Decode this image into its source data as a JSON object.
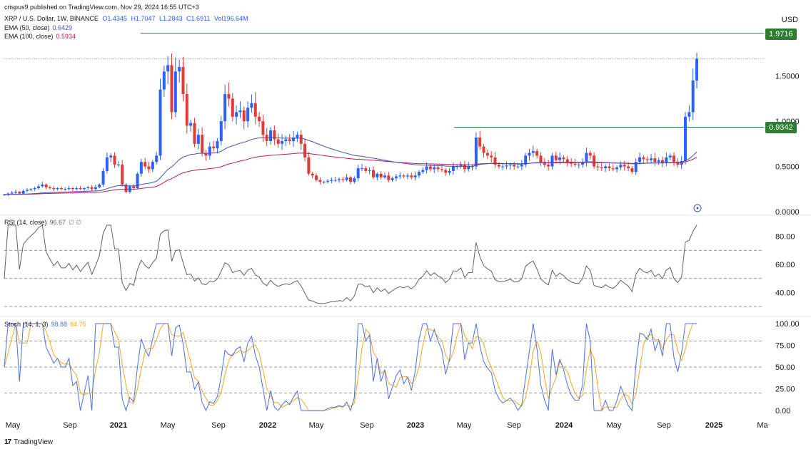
{
  "header": {
    "publisher_line": "crispus9 published on TradingView.com, Nov 29, 2024 16:55 UTC+3",
    "symbol": "XRP / U.S. Dollar, 1W, BINANCE",
    "open": "O1.4345",
    "high": "H1.7047",
    "low": "L1.2843",
    "close": "C1.6911",
    "volume": "Vol196.64M",
    "ema50_label": "EMA (50, close)",
    "ema50_value": "0.6429",
    "ema100_label": "EMA (100, close)",
    "ema100_value": "0.5934",
    "rsi_label": "RSI (14, close)",
    "rsi_value": "96.67",
    "rsi_extra": "∅ ∅",
    "stoch_label": "Stoch (14, 1, 3)",
    "stoch_k": "98.88",
    "stoch_d": "84.75"
  },
  "price_axis": {
    "unit": "USD",
    "ticks": [
      "1.5000",
      "1.0000",
      "0.5000",
      "0.0000"
    ],
    "tags": [
      "1.9716",
      "0.9342"
    ]
  },
  "rsi_axis": {
    "ticks": [
      "80.00",
      "60.00",
      "40.00"
    ]
  },
  "stoch_axis": {
    "ticks": [
      "100.00",
      "75.00",
      "50.00",
      "25.00",
      "0.00"
    ]
  },
  "time_axis": {
    "labels": [
      "May",
      "Sep",
      "2021",
      "May",
      "Sep",
      "2022",
      "May",
      "Sep",
      "2023",
      "May",
      "Sep",
      "2024",
      "May",
      "Sep",
      "2025",
      "Ma"
    ]
  },
  "brand": {
    "name": "TradingView"
  },
  "colors": {
    "up": "#2962ff",
    "down": "#e53935",
    "ema50": "#3f51b5",
    "ema100": "#c2185b",
    "rsi": "#5d5d7a",
    "stochK": "#4a6fe3",
    "stochD": "#f5a623",
    "level": "#2e7d32"
  },
  "chart_data": [
    {
      "type": "candlestick",
      "title": "XRP / U.S. Dollar, 1W, BINANCE",
      "ylabel": "USD",
      "ylim": [
        0,
        2.05
      ],
      "levels": [
        1.9716,
        0.9342
      ],
      "weekly_close": [
        0.19,
        0.2,
        0.21,
        0.22,
        0.2,
        0.23,
        0.24,
        0.25,
        0.26,
        0.28,
        0.3,
        0.27,
        0.26,
        0.25,
        0.26,
        0.25,
        0.25,
        0.26,
        0.25,
        0.26,
        0.25,
        0.26,
        0.27,
        0.25,
        0.27,
        0.3,
        0.45,
        0.6,
        0.62,
        0.52,
        0.52,
        0.3,
        0.22,
        0.28,
        0.26,
        0.42,
        0.55,
        0.5,
        0.47,
        0.55,
        0.62,
        1.35,
        1.55,
        1.62,
        1.1,
        1.55,
        1.6,
        1.3,
        0.95,
        0.98,
        0.75,
        0.85,
        0.65,
        0.62,
        0.72,
        0.7,
        0.78,
        1.0,
        1.3,
        1.25,
        1.05,
        1.1,
        1.12,
        1.0,
        1.15,
        1.2,
        1.05,
        1.0,
        0.85,
        0.78,
        0.9,
        0.8,
        0.75,
        0.78,
        0.8,
        0.78,
        0.82,
        0.85,
        0.75,
        0.6,
        0.42,
        0.4,
        0.35,
        0.33,
        0.33,
        0.34,
        0.35,
        0.35,
        0.36,
        0.35,
        0.38,
        0.33,
        0.37,
        0.48,
        0.48,
        0.45,
        0.46,
        0.38,
        0.42,
        0.38,
        0.4,
        0.35,
        0.37,
        0.39,
        0.4,
        0.39,
        0.4,
        0.38,
        0.4,
        0.44,
        0.46,
        0.5,
        0.47,
        0.49,
        0.47,
        0.46,
        0.43,
        0.45,
        0.5,
        0.5,
        0.52,
        0.47,
        0.5,
        0.5,
        0.82,
        0.72,
        0.65,
        0.62,
        0.6,
        0.52,
        0.5,
        0.5,
        0.51,
        0.52,
        0.5,
        0.5,
        0.52,
        0.62,
        0.65,
        0.67,
        0.62,
        0.55,
        0.52,
        0.5,
        0.62,
        0.57,
        0.6,
        0.58,
        0.55,
        0.53,
        0.52,
        0.52,
        0.55,
        0.65,
        0.62,
        0.5,
        0.49,
        0.48,
        0.5,
        0.48,
        0.47,
        0.49,
        0.52,
        0.5,
        0.48,
        0.44,
        0.55,
        0.6,
        0.58,
        0.57,
        0.59,
        0.55,
        0.57,
        0.54,
        0.6,
        0.62,
        0.55,
        0.52,
        0.56,
        1.05,
        1.1,
        1.45,
        1.69
      ],
      "ema50_end": 0.6429,
      "ema100_end": 0.5934
    },
    {
      "type": "line",
      "title": "RSI (14, close)",
      "ylim": [
        25,
        90
      ],
      "levels": [
        70,
        50,
        30
      ],
      "series": [
        {
          "name": "RSI",
          "last": 96.67
        }
      ]
    },
    {
      "type": "line",
      "title": "Stoch (14, 1, 3)",
      "ylim": [
        -5,
        105
      ],
      "levels": [
        80,
        50,
        20
      ],
      "series": [
        {
          "name": "%K",
          "last": 98.88
        },
        {
          "name": "%D",
          "last": 84.75
        }
      ]
    }
  ]
}
